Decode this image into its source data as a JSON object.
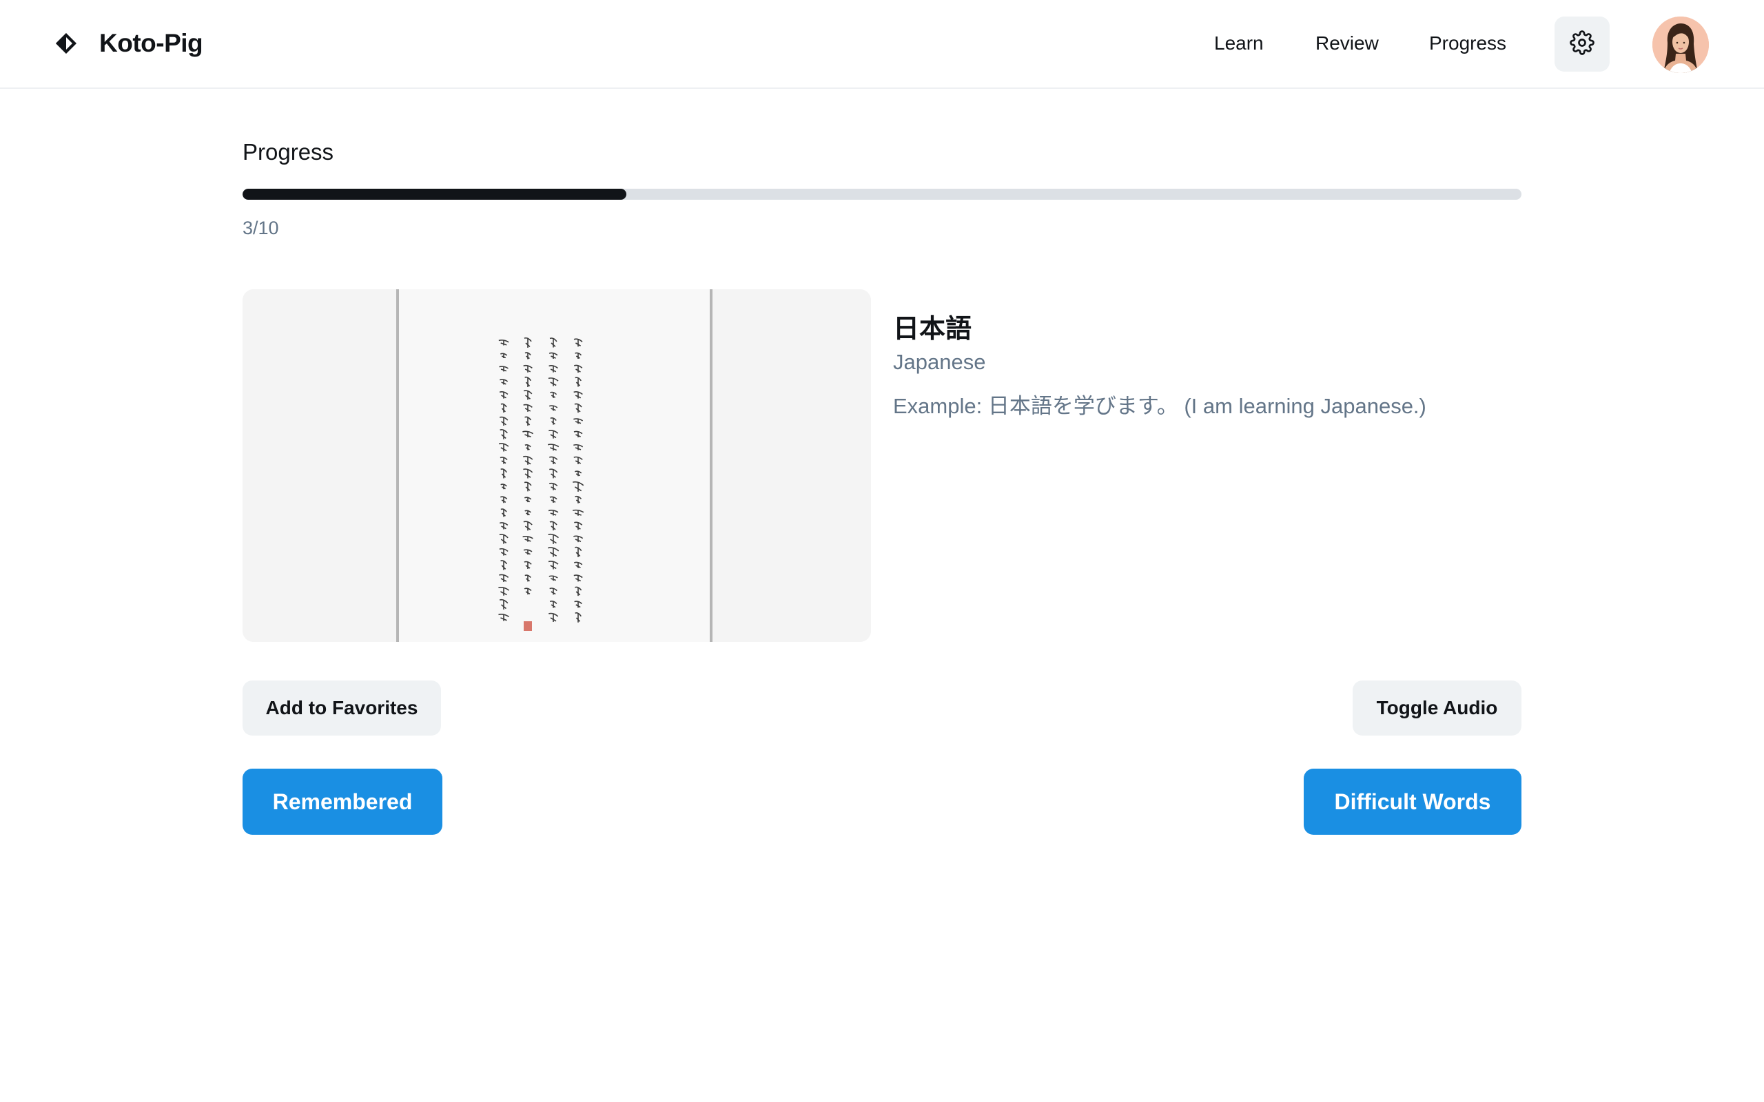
{
  "header": {
    "brand_name": "Koto-Pig",
    "brand_icon": "diamond-logo-icon",
    "nav": [
      {
        "label": "Learn"
      },
      {
        "label": "Review"
      },
      {
        "label": "Progress"
      }
    ],
    "settings_icon": "gear-icon",
    "avatar_icon": "user-avatar"
  },
  "progress": {
    "title": "Progress",
    "current": 3,
    "total": 10,
    "fraction": 0.3,
    "text": "3/10"
  },
  "card": {
    "image_icon": "calligraphy-scroll-image",
    "word": "日本語",
    "translation": "Japanese",
    "example": "Example: 日本語を学びます。 (I am learning Japanese.)"
  },
  "actions": {
    "favorites_label": "Add to Favorites",
    "audio_label": "Toggle Audio",
    "remembered_label": "Remembered",
    "difficult_label": "Difficult Words"
  },
  "colors": {
    "accent": "#1a8fe3",
    "text_primary": "#111418",
    "text_secondary": "#637588",
    "progress_fill": "#111418",
    "progress_track": "#dce0e5",
    "button_secondary_bg": "#eff2f4"
  }
}
